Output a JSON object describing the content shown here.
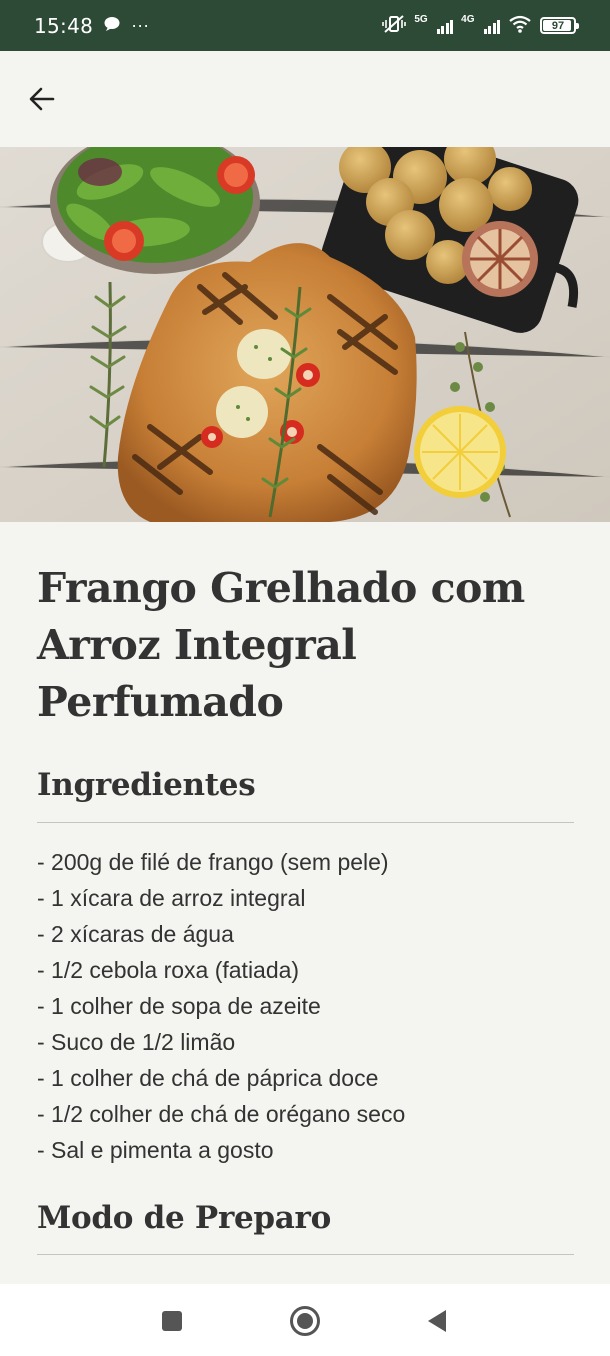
{
  "status_bar": {
    "time": "15:48",
    "chat_icon": "chat-bubble-icon",
    "more": "···",
    "network_5g": "5G",
    "network_4g": "4G",
    "battery": "97"
  },
  "app_bar": {
    "back_icon": "arrow-back-icon"
  },
  "hero": {
    "image": "grilled-chicken-with-salad-potatoes-lemon-photo"
  },
  "recipe": {
    "title": "Frango Grelhado com Arroz Integral Perfumado",
    "ingredients_heading": "Ingredientes",
    "ingredients": [
      "- 200g de filé de frango (sem pele)",
      "- 1 xícara de arroz integral",
      "- 2 xícaras de água",
      "- 1/2 cebola roxa (fatiada)",
      "- 1 colher de sopa de azeite",
      "- Suco de 1/2 limão",
      "- 1 colher de chá de páprica doce",
      "- 1/2 colher de chá de orégano seco",
      "- Sal e pimenta a gosto"
    ],
    "preparation_heading": "Modo de Preparo"
  },
  "nav_bar": {
    "recents_icon": "square-recents-icon",
    "home_icon": "circle-home-icon",
    "back_icon": "triangle-back-icon"
  },
  "colors": {
    "status_bar": "#2d4a37",
    "background": "#f4f4f0",
    "text": "#333333"
  }
}
